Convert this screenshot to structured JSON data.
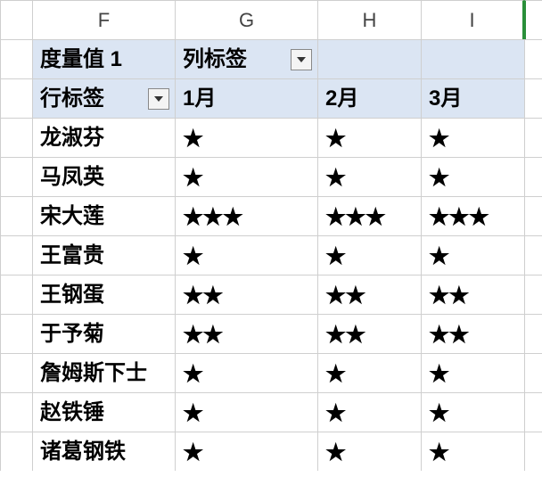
{
  "column_headers": {
    "F": "F",
    "G": "G",
    "H": "H",
    "I": "I"
  },
  "pivot": {
    "measure_label": "度量值 1",
    "column_labels_caption": "列标签",
    "row_labels_caption": "行标签",
    "months": {
      "m1": "1月",
      "m2": "2月",
      "m3": "3月"
    }
  },
  "rows": [
    {
      "name": "龙淑芬",
      "m1": "★",
      "m2": "★",
      "m3": "★"
    },
    {
      "name": "马凤英",
      "m1": "★",
      "m2": "★",
      "m3": "★"
    },
    {
      "name": "宋大莲",
      "m1": "★★★",
      "m2": "★★★",
      "m3": "★★★"
    },
    {
      "name": "王富贵",
      "m1": "★",
      "m2": "★",
      "m3": "★"
    },
    {
      "name": "王钢蛋",
      "m1": "★★",
      "m2": "★★",
      "m3": "★★"
    },
    {
      "name": "于予菊",
      "m1": "★★",
      "m2": "★★",
      "m3": "★★"
    },
    {
      "name": "詹姆斯下士",
      "m1": "★",
      "m2": "★",
      "m3": "★"
    },
    {
      "name": "赵铁锤",
      "m1": "★",
      "m2": "★",
      "m3": "★"
    },
    {
      "name": "诸葛钢铁",
      "m1": "★",
      "m2": "★",
      "m3": "★"
    }
  ]
}
